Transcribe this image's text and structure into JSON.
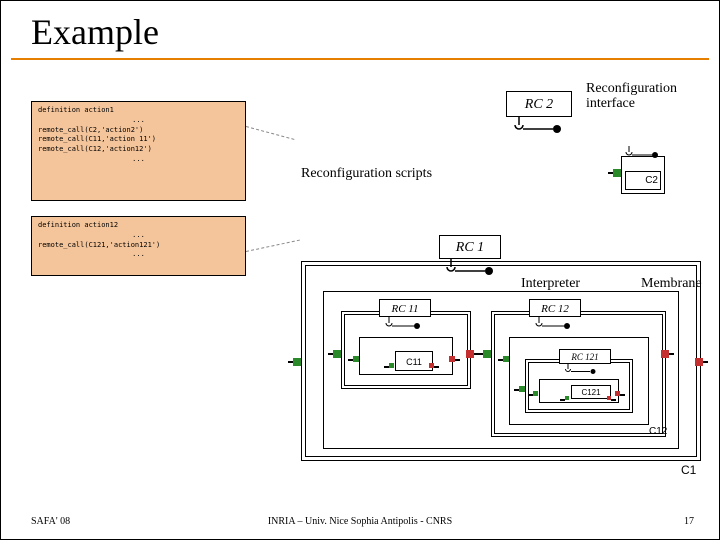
{
  "title": "Example",
  "labels": {
    "reconfig_interface": "Reconfiguration interface",
    "reconfig_scripts": "Reconfiguration scripts",
    "interpreter": "Interpreter",
    "membrane": "Membrane"
  },
  "components": {
    "rc2": "RC 2",
    "c2": "C2",
    "rc1": "RC 1",
    "c1": "C1",
    "rc11": "RC 11",
    "c11": "C11",
    "rc12": "RC 12",
    "c12": "C12",
    "rc121": "RC 121",
    "c121": "C121"
  },
  "scripts": {
    "s1": {
      "l1": "definition action1",
      "l2": "...",
      "l3": "remote_call(C2,'action2')",
      "l4": "remote_call(C11,'action 11')",
      "l5": "remote_call(C12,'action12')",
      "l6": "..."
    },
    "s2": {
      "l1": "definition action12",
      "l2": "...",
      "l3": "remote_call(C121,'action121')",
      "l4": "..."
    }
  },
  "footer": {
    "left": "SAFA' 08",
    "center": "INRIA – Univ. Nice Sophia Antipolis - CNRS",
    "right": "17"
  }
}
